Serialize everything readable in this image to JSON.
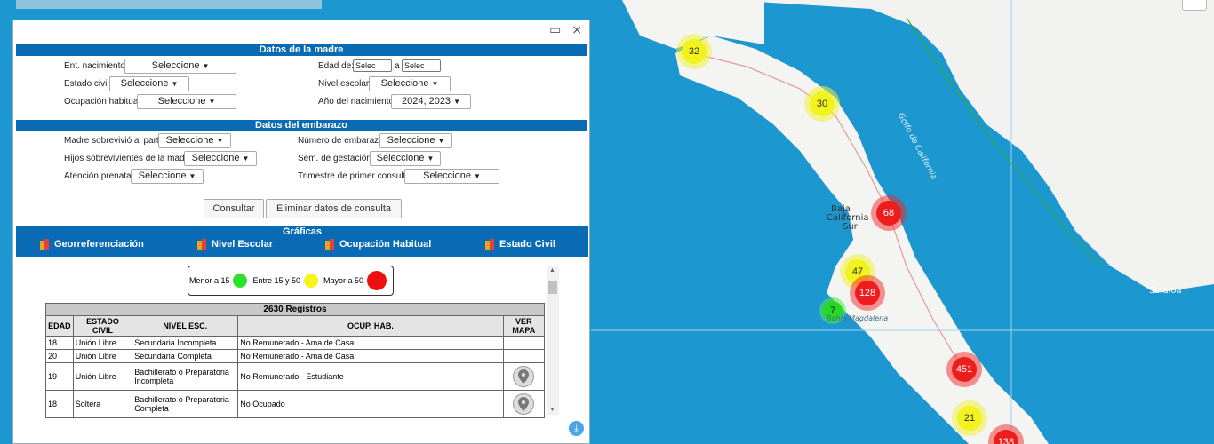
{
  "window_controls": "▭ ⨯",
  "madre": {
    "title": "Datos de la madre",
    "ent_nac_label": "Ent. nacimiento:",
    "ent_nac_value": "Seleccione",
    "edad_label": "Edad de:",
    "edad_from": "Selec",
    "edad_sep": "a",
    "edad_to": "Selec",
    "estado_civil_label": "Estado civil:",
    "estado_civil_value": "Seleccione",
    "nivel_label": "Nivel escolar:",
    "nivel_value": "Seleccione",
    "ocup_label": "Ocupación habitual:",
    "ocup_value": "Seleccione",
    "anio_label": "Año del nacimiento:",
    "anio_value": "2024, 2023"
  },
  "embarazo": {
    "title": "Datos del embarazo",
    "sobrevivio_label": "Madre sobrevivió al parto:",
    "sobrevivio_value": "Seleccione",
    "num_emb_label": "Número de embarazo:",
    "num_emb_value": "Seleccione",
    "hijos_label": "Hijos sobrevivientes de la madre:",
    "hijos_value": "Seleccione",
    "sem_label": "Sem. de gestación:",
    "sem_value": "Seleccione",
    "prenatal_label": "Atención prenatal:",
    "prenatal_value": "Seleccione",
    "trimestre_label": "Trimestre de primer consulta:",
    "trimestre_value": "Seleccione"
  },
  "actions": {
    "consultar": "Consultar",
    "eliminar": "Eliminar datos de consulta"
  },
  "graficas": {
    "title": "Gráficas",
    "links": [
      "Georreferenciación",
      "Nivel Escolar",
      "Ocupación Habitual",
      "Estado Civil"
    ]
  },
  "legend": {
    "low": "Menor a 15",
    "mid": "Entre 15 y 50",
    "high": "Mayor a 50",
    "colors": {
      "low": "#2ce02c",
      "mid": "#f5f51a",
      "high": "#ee1010"
    }
  },
  "table": {
    "caption": "2630 Registros",
    "headers": [
      "EDAD",
      "ESTADO CIVIL",
      "NIVEL ESC.",
      "OCUP. HAB.",
      "VER MAPA"
    ],
    "rows": [
      [
        "18",
        "Unión Libre",
        "Secundaria Incompleta",
        "No Remunerado - Ama de Casa",
        ""
      ],
      [
        "20",
        "Unión Libre",
        "Secundaria Completa",
        "No Remunerado - Ama de Casa",
        ""
      ],
      [
        "19",
        "Unión Libre",
        "Bachillerato o Preparatoria Incompleta",
        "No Remunerado - Estudiante",
        "map-pin-icon"
      ],
      [
        "18",
        "Soltera",
        "Bachillerato o Preparatoria Completa",
        "No Ocupado",
        "map-pin-icon"
      ]
    ]
  },
  "map": {
    "clusters": [
      "32",
      "30",
      "68",
      "47",
      "128",
      "7",
      "451",
      "21",
      "138"
    ],
    "labels": {
      "baja": "Baja",
      "california": "California",
      "sur": "Sur",
      "golfo": "Golfo de California",
      "magdalena": "Bahía Magdalena",
      "sinaloa": "Sinaloa"
    },
    "zoom_label": "−"
  }
}
